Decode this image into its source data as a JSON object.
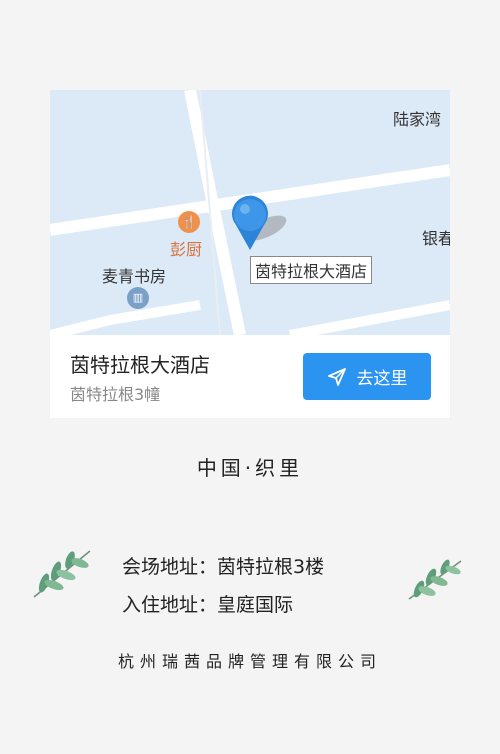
{
  "map": {
    "labels": {
      "lujiawan": "陆家湾",
      "yin": "银春",
      "pengchu": "彭厨",
      "maiqing": "麦青书房"
    },
    "pin_label": "茵特拉根大酒店"
  },
  "location_card": {
    "title": "茵特拉根大酒店",
    "subtitle": "茵特拉根3幢",
    "button_label": "去这里"
  },
  "region": "中国·织里",
  "venue_address": "会场地址：茵特拉根3楼",
  "stay_address": "入住地址：皇庭国际",
  "company": "杭州瑞茜品牌管理有限公司",
  "colors": {
    "accent": "#2b93f0",
    "map_water": "#dce9f6",
    "map_road": "#ffffff",
    "leaf": "#5f9e7a"
  }
}
